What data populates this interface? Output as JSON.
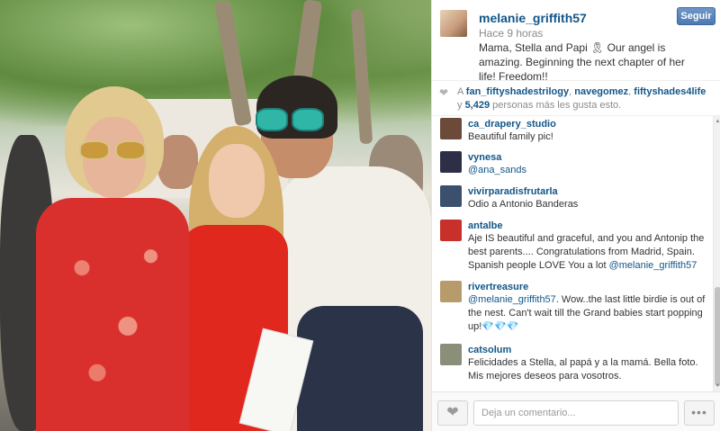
{
  "post": {
    "username": "melanie_griffith57",
    "time": "Hace 9 horas",
    "caption": "Mama, Stella and Papi 🎗 Our angel is amazing. Beginning the next chapter of her life! Freedom!!",
    "follow_label": "Seguir"
  },
  "likes": {
    "prefix": "A",
    "users": [
      "fan_fiftyshadestrilogy",
      "navegomez",
      "fiftyshades4life"
    ],
    "separator_1": ",",
    "separator_2": ",",
    "joiner": "y",
    "count": "5,429",
    "suffix": "personas más les gusta esto."
  },
  "comments": [
    {
      "user": "ca_drapery_studio",
      "text": "Beautiful family pic!",
      "avatar_color": "#6b4a3a"
    },
    {
      "user": "vynesa",
      "mention": "@ana_sands",
      "text": "",
      "avatar_color": "#2c2f45"
    },
    {
      "user": "vivirparadisfrutarla",
      "text": "Odio a Antonio Banderas",
      "avatar_color": "#3b4f6e"
    },
    {
      "user": "antalbe",
      "text": "Aje IS beautiful and graceful, and you and Antonip the best parents.... Congratulations from Madrid, Spain. Spanish people LOVE You a lot ",
      "mention": "@melanie_griffith57",
      "avatar_color": "#c8312a"
    },
    {
      "user": "rivertreasure",
      "mention": "@melanie_griffith57",
      "text": ". Wow..the last little birdie is out of the nest. Can't wait till the Grand babies start popping up!💎💎💎",
      "avatar_color": "#b89b6b"
    },
    {
      "user": "catsolum",
      "text": "Felicidades a Stella, al papá y a la mamá. Bella foto. Mis mejores deseos para vosotros.",
      "avatar_color": "#8a8f7a"
    }
  ],
  "footer": {
    "comment_placeholder": "Deja un comentario...",
    "more_label": "•••"
  },
  "icons": {
    "heart": "heart-icon",
    "like": "heart-icon",
    "more": "more-dots-icon"
  },
  "colors": {
    "link": "#125688",
    "follow_button": "#4d7ab3"
  }
}
